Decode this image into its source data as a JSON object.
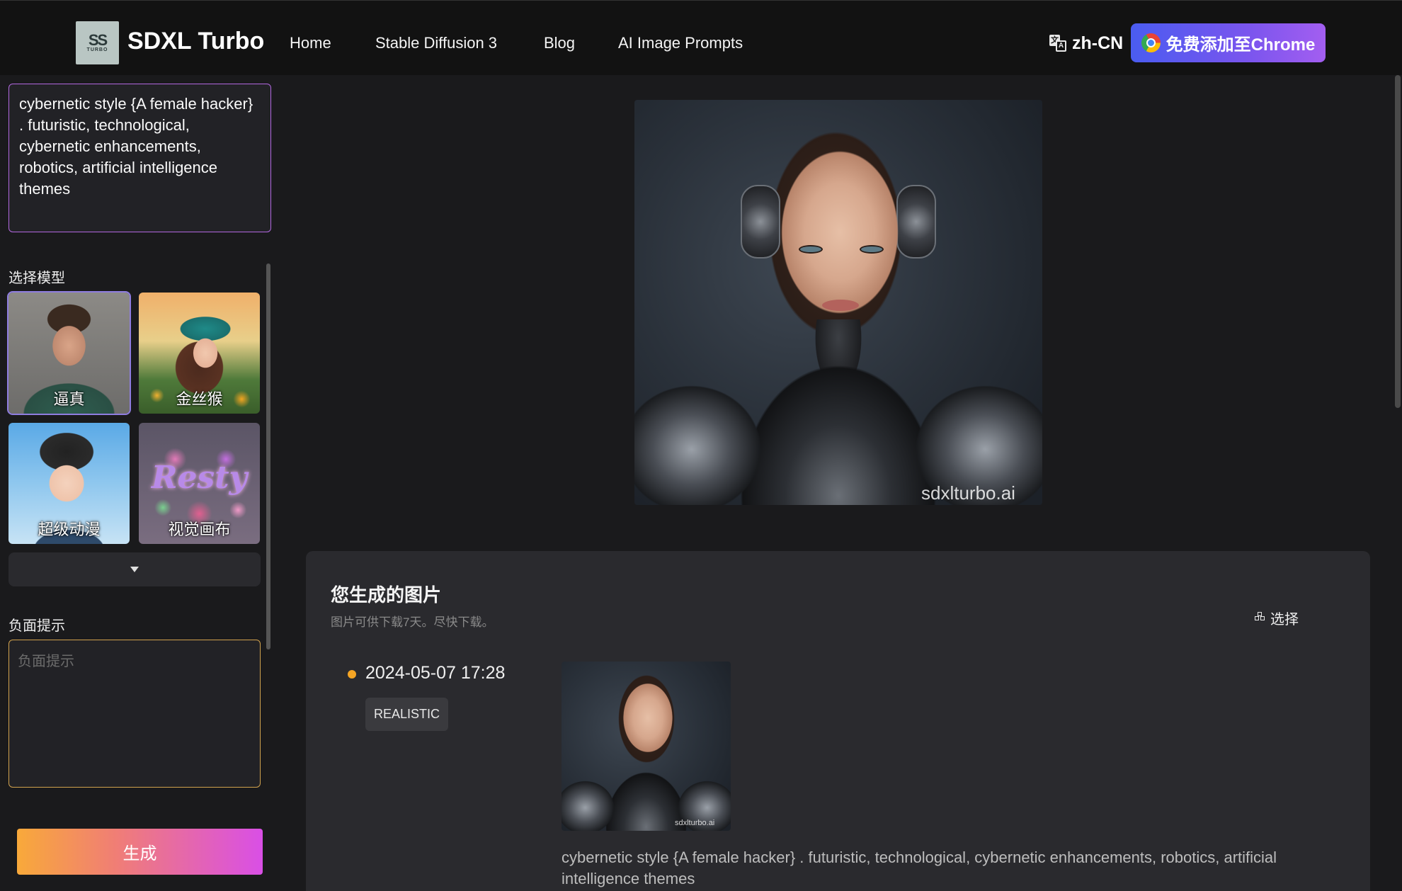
{
  "header": {
    "brand": "SDXL Turbo",
    "logo_text_main": "SS",
    "logo_text_sub": "TURBO",
    "nav": [
      "Home",
      "Stable Diffusion 3",
      "Blog",
      "AI Image Prompts"
    ],
    "language": "zh-CN",
    "chrome_button": "免费添加至Chrome"
  },
  "left_panel": {
    "prompt": "cybernetic style {A female hacker} . futuristic, technological, cybernetic enhancements, robotics, artificial intelligence themes",
    "model_section_label": "选择模型",
    "models": [
      {
        "label": "逼真",
        "selected": true
      },
      {
        "label": "金丝猴",
        "selected": false
      },
      {
        "label": "超级动漫",
        "selected": false
      },
      {
        "label": "视觉画布",
        "selected": false
      }
    ],
    "model_4_art_text": "Resty",
    "negative_label": "负面提示",
    "negative_placeholder": "负面提示",
    "negative_value": "",
    "generate_button": "生成"
  },
  "main": {
    "hero_watermark": "sdxlturbo.ai",
    "results": {
      "title": "您生成的图片",
      "subtitle": "图片可供下载7天。尽快下载。",
      "select_label": "选择",
      "items": [
        {
          "datetime": "2024-05-07 17:28",
          "tag": "REALISTIC",
          "watermark": "sdxlturbo.ai",
          "prompt": "cybernetic style {A female hacker} . futuristic, technological, cybernetic enhancements, robotics, artificial intelligence themes"
        }
      ]
    }
  },
  "colors": {
    "header_bg": "#121212",
    "page_bg": "#1a1a1c",
    "prompt_border": "#b268e0",
    "negative_border": "#d1a24e",
    "status_dot": "#f5a524"
  },
  "icons": [
    "translate-icon",
    "chrome-logo-icon",
    "chevron-down-icon",
    "grid-select-icon"
  ]
}
